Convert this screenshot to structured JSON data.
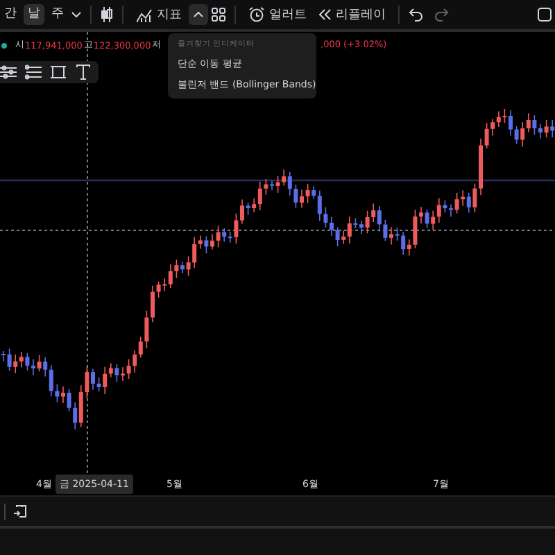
{
  "toolbar": {
    "intervals": [
      {
        "label": "간",
        "selected": false
      },
      {
        "label": "날",
        "selected": true
      },
      {
        "label": "주",
        "selected": false
      }
    ],
    "indicators_button": {
      "label": "지표"
    },
    "favorites_toggle": {
      "expanded": true
    },
    "alert_button": {
      "label": "얼러트"
    },
    "replay_button": {
      "label": "리플레이"
    }
  },
  "legend": {
    "ohlc": [
      {
        "label": "시",
        "value": "117,941,000"
      },
      {
        "label": "고",
        "value": "122,300,000"
      },
      {
        "label": "저"
      }
    ],
    "change": ",000 (+3.02%)"
  },
  "favorites_menu": {
    "header": "즐겨찾기 인디케이터",
    "items": [
      {
        "label": "단순 이동 평균"
      },
      {
        "label": "볼린저 밴드 (Bollinger Bands)"
      }
    ]
  },
  "x_axis": {
    "labels": [
      "4월",
      "5월",
      "6월",
      "7월"
    ],
    "crosshair_label": "금 2025-04-11"
  }
}
